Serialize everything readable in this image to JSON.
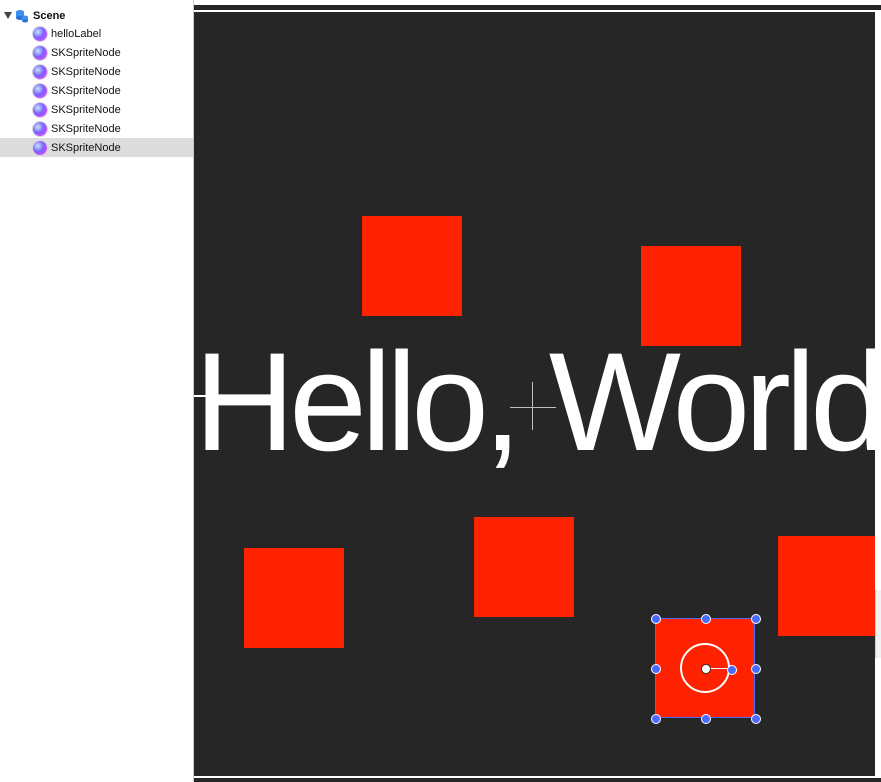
{
  "outline": {
    "root_label": "Scene",
    "items": [
      {
        "label": "helloLabel",
        "selected": false
      },
      {
        "label": "SKSpriteNode",
        "selected": false
      },
      {
        "label": "SKSpriteNode",
        "selected": false
      },
      {
        "label": "SKSpriteNode",
        "selected": false
      },
      {
        "label": "SKSpriteNode",
        "selected": false
      },
      {
        "label": "SKSpriteNode",
        "selected": false
      },
      {
        "label": "SKSpriteNode",
        "selected": true
      }
    ]
  },
  "scene": {
    "label_text": "Hello, World",
    "background_color": "#262626",
    "sprite_color": "#ff2200",
    "selection_color": "#4b6bff"
  }
}
